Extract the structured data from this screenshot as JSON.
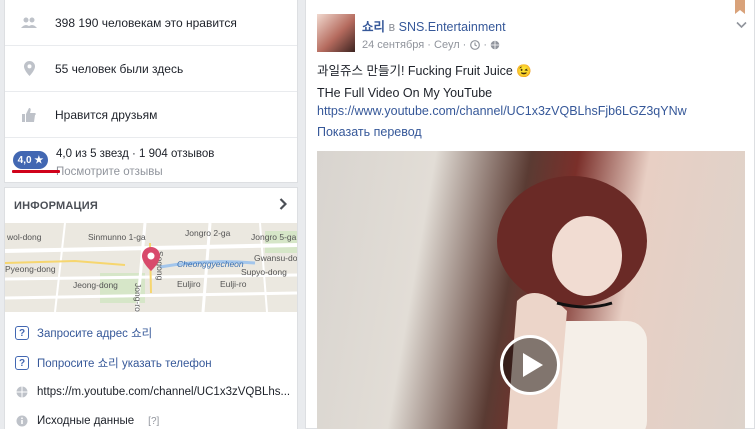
{
  "left": {
    "likes": "398 190 человекам это нравится",
    "checkins": "55 человек были здесь",
    "friends_like": "Нравится друзьям",
    "rating_badge": "4,0 ★",
    "rating_summary": "4,0 из 5 звезд · 1 904 отзывов",
    "see_reviews": "Посмотрите отзывы"
  },
  "info": {
    "title": "ИНФОРМАЦИЯ",
    "map_labels": [
      "wol-dong",
      "Sinmunno 1-ga",
      "Jongro 2-ga",
      "Jongro 5-ga",
      "Gwansu-dong",
      "Pyeong-dong",
      "Cheonggyecheon",
      "Supyo-dong",
      "Jeong-dong",
      "Euljiro",
      "Eulji-ro",
      "Sogong",
      "Jong-ro"
    ],
    "ask_address": "Запросите адрес 쇼리",
    "ask_phone": "Попросите 쇼리 указать телефон",
    "website": "https://m.youtube.com/channel/UC1x3zVQBLhs...",
    "source": "Исходные данные",
    "source_help": "[?]"
  },
  "post": {
    "author": "쇼리",
    "in_word": " в ",
    "page": "SNS.Entertainment",
    "date": "24 сентября · Сеул ·",
    "line1": "과일쥬스 만들기! Fucking Fruit Juice 😉",
    "line2": "THe Full Video On My YouTube",
    "link": "https://www.youtube.com/channel/UC1x3zVQBLhsFjb6LGZ3qYNw",
    "translate": "Показать перевод"
  },
  "colors": {
    "brand": "#4267b2",
    "link": "#365899",
    "underline_red": "#d0021b"
  }
}
